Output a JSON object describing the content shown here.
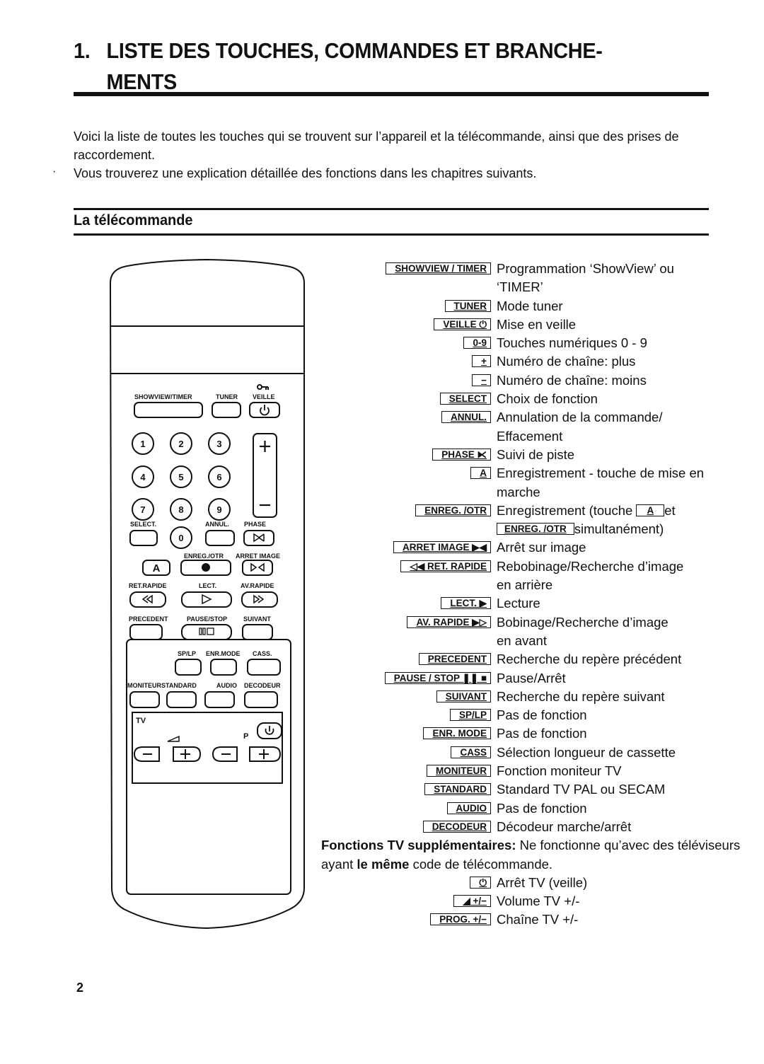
{
  "heading": {
    "number": "1.",
    "line1": "LISTE DES TOUCHES, COMMANDES ET BRANCHE-",
    "line2": "MENTS"
  },
  "intro": {
    "para1": "Voici la liste de toutes les touches qui se trouvent sur l’appareil et la télécommande, ainsi que des prises de raccordement.",
    "para2": "Vous trouverez une explication détaillée des fonctions dans les chapitres suivants."
  },
  "section": {
    "title": "La télécommande"
  },
  "remote": {
    "labels": {
      "showview": "SHOWVIEW/TIMER",
      "tuner": "TUNER",
      "veille": "VEILLE",
      "select": "SELECT.",
      "annul": "ANNUL.",
      "phase": "PHASE",
      "enreg": "ENREG./OTR",
      "arret_image": "ARRET IMAGE",
      "ret_rapide": "RET.RAPIDE",
      "lect": "LECT.",
      "av_rapide": "AV.RAPIDE",
      "precedent": "PRECEDENT",
      "pause_stop": "PAUSE/STOP",
      "suivant": "SUIVANT",
      "splp": "SP/LP",
      "enr_mode": "ENR.MODE",
      "cass": "CASS.",
      "moniteur": "MONITEUR",
      "standard": "STANDARD",
      "audio": "AUDIO",
      "decodeur": "DECODEUR",
      "tv": "TV",
      "p": "P"
    },
    "digits": [
      "1",
      "2",
      "3",
      "4",
      "5",
      "6",
      "7",
      "8",
      "9",
      "0"
    ],
    "a_key": "A",
    "plus": "+",
    "minus": "−"
  },
  "keys": [
    {
      "key": "SHOWVIEW / TIMER",
      "desc": [
        "Programmation ‘ShowView’ ou",
        "‘TIMER’"
      ]
    },
    {
      "key": "TUNER",
      "desc": [
        "Mode tuner"
      ]
    },
    {
      "key": "VEILLE ⏻",
      "desc": [
        "Mise en veille"
      ]
    },
    {
      "key": "0-9",
      "desc": [
        "Touches numériques 0 - 9"
      ]
    },
    {
      "key": "+",
      "desc": [
        "Numéro de chaîne: plus"
      ]
    },
    {
      "key": "−",
      "desc": [
        "Numéro de chaîne: moins"
      ]
    },
    {
      "key": "SELECT",
      "desc": [
        "Choix de fonction"
      ]
    },
    {
      "key": "ANNUL.",
      "desc": [
        "Annulation de la commande/",
        "Effacement"
      ]
    },
    {
      "key": "PHASE ⧔",
      "desc": [
        "Suivi de piste"
      ]
    },
    {
      "key": "A",
      "desc": [
        "Enregistrement - touche de mise en",
        "marche"
      ]
    },
    {
      "key": "ENREG. /OTR",
      "desc_special": {
        "before": "Enregistrement (touche ",
        "inline_key": "A",
        "after": "et",
        "line2_key": "ENREG. /OTR",
        "line2_after": "simultanément)"
      }
    },
    {
      "key": "ARRET IMAGE ▶◀",
      "desc": [
        "Arrêt sur image"
      ]
    },
    {
      "key": "◁◀ RET. RAPIDE",
      "desc": [
        "Rebobinage/Recherche d’image",
        "en arrière"
      ]
    },
    {
      "key": "LECT. ▶",
      "desc": [
        "Lecture"
      ]
    },
    {
      "key": "AV. RAPIDE ▶▷",
      "desc": [
        "Bobinage/Recherche d’image",
        "en avant"
      ]
    },
    {
      "key": "PRECEDENT",
      "desc": [
        "Recherche du repère précédent"
      ]
    },
    {
      "key": "PAUSE / STOP ❚❚ ■",
      "desc": [
        "Pause/Arrêt"
      ]
    },
    {
      "key": "SUIVANT",
      "desc": [
        "Recherche du repère suivant"
      ]
    },
    {
      "key": "SP/LP",
      "desc": [
        "Pas de fonction"
      ]
    },
    {
      "key": "ENR. MODE",
      "desc": [
        "Pas de fonction"
      ]
    },
    {
      "key": "CASS",
      "desc": [
        "Sélection longueur de cassette"
      ]
    },
    {
      "key": "MONITEUR",
      "desc": [
        "Fonction moniteur TV"
      ]
    },
    {
      "key": "STANDARD",
      "desc": [
        "Standard TV PAL ou SECAM"
      ]
    },
    {
      "key": "AUDIO",
      "desc": [
        "Pas de fonction"
      ]
    },
    {
      "key": "DECODEUR",
      "desc": [
        "Décodeur marche/arrêt"
      ]
    }
  ],
  "tv_note": {
    "bold": "Fonctions TV supplémentaires:",
    "text1": " Ne fonctionne qu’avec des téléviseurs ayant ",
    "bold2": "le même",
    "text2": " code de télécommande."
  },
  "tv_keys": [
    {
      "key": "⏻",
      "desc": "Arrêt TV (veille)"
    },
    {
      "key": "◢ +/−",
      "desc": "Volume TV +/-"
    },
    {
      "key": "PROG. +/−",
      "desc": "Chaîne TV +/-"
    }
  ],
  "page_number": "2"
}
